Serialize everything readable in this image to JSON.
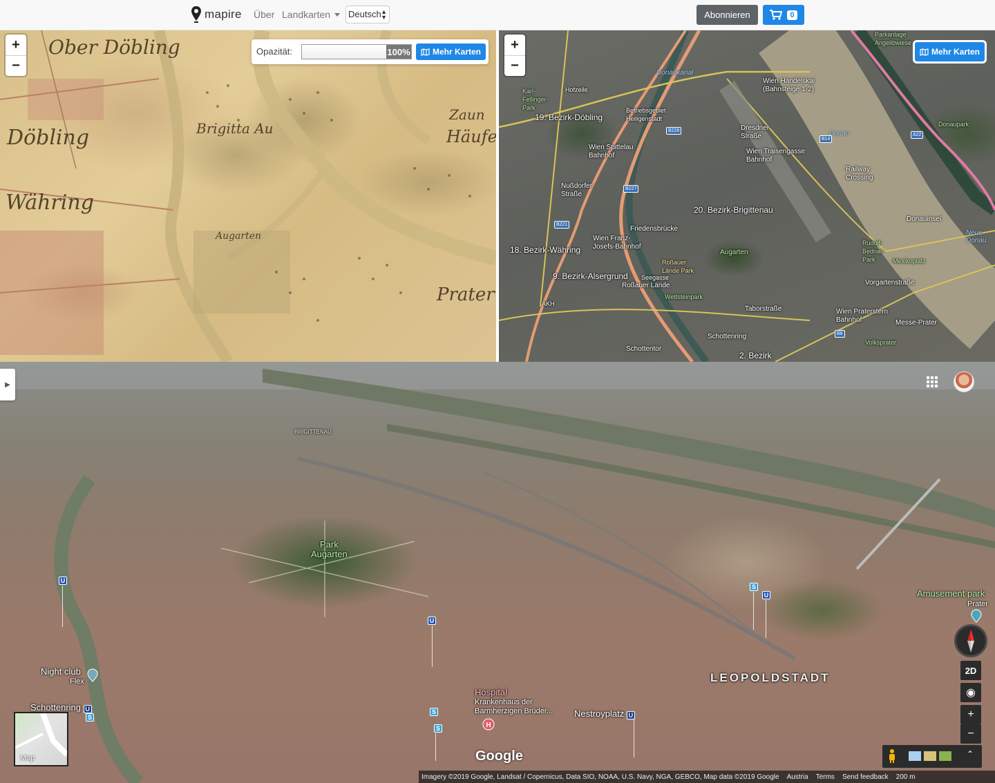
{
  "navbar": {
    "brand": "mapire",
    "links": {
      "ueber": "Über",
      "landkarten": "Landkarten"
    },
    "language": "Deutsch",
    "subscribe": "Abonnieren",
    "cart_count": "0"
  },
  "historic_map": {
    "zoom_in": "+",
    "zoom_out": "−",
    "opacity_label": "Opazität:",
    "opacity_value": "100%",
    "opacity_fraction": 1.0,
    "more_maps": "Mehr Karten",
    "labels": {
      "oberdobling": "Ober Döbling",
      "dobling": "Döbling",
      "wahring": "Währing",
      "prater": "Prater",
      "haufel": "Häufel",
      "zaun": "Zaun",
      "brigitta": "Brigitta Au",
      "augarten": "Augarten"
    }
  },
  "satellite_map": {
    "zoom_in": "+",
    "zoom_out": "−",
    "more_maps": "Mehr Karten",
    "labels": {
      "bezirk19": "19. Bezirk-Döbling",
      "bezirk20": "20. Bezirk-Brigittenau",
      "bezirk18": "18. Bezirk-Währing",
      "bezirk9": "9. Bezirk-Alsergrund",
      "bezirk2": "2. Bezirk",
      "handelskai": "Wien Handelskai (Bahnsteige 1-2)",
      "traisengasse": "Wien Traisengasse Bahnhof",
      "spittelau": "Wien Spittelau Bahnhof",
      "franzjosefs": "Wien Franz-Josefs-Bahnhof",
      "nussdorfer": "Nußdorfer Straße",
      "friedensbruecke": "Friedensbrücke",
      "rossauer_park": "Roßauer Lände Park",
      "rossauer_laende": "Roßauer Lände",
      "augarten": "Augarten",
      "donauinsel": "Donauinsel",
      "vorgartenstrasse": "Vorgartenstraße",
      "mexikoplatz": "Mexikoplatz",
      "praterstern": "Wien Praterstern Bahnhof",
      "messe_prater": "Messe-Prater",
      "taborstrasse": "Taborstraße",
      "schottenring": "Schottenring",
      "schottentor": "Schottentor",
      "neue_donau": "Neue Donau",
      "donaukanal": "Donaukanal",
      "donau": "Donau",
      "dresdner": "Dresdner Straße",
      "railway_crossing": "Railway Crossing",
      "donaupark": "Donaupark",
      "karl_fellinger": "Karl-Fellinger-Park",
      "heiligenstadt": "Betriebsgebiet Heiligenstadt",
      "volksprater": "Volksprater",
      "seegasse": "Seegasse",
      "wettsteinpark": "Wettsteinpark",
      "akh": "AKH",
      "hoefzeile": "Hofzeile",
      "parkanlage": "Parkanlage Angelibwiese",
      "rudolf_bednar": "Rudolf-Bednar-Park"
    }
  },
  "earth_3d": {
    "labels": {
      "brigittenau": "BRIGITTENAU",
      "park_augarten": "Park\nAugarten",
      "amusement_park": "Amusement park",
      "prater": "Prater",
      "night_club": "Night club",
      "flex": "Flex",
      "schottenring": "Schottenring",
      "hospital": "Hospital",
      "krankenhaus": "Krankenhaus der\nBarmherzigen Brüder...",
      "nestroyplatz": "Nestroyplatz",
      "leopoldstadt": "LEOPOLDSTADT"
    },
    "mini_map_label": "Map",
    "view_2d": "2D",
    "google": "Google",
    "attribution": {
      "imagery": "Imagery ©2019 Google, Landsat / Copernicus, Data SIO, NOAA, U.S. Navy, NGA, GEBCO, Map data ©2019 Google",
      "country": "Austria",
      "terms": "Terms",
      "feedback": "Send feedback",
      "scale": "200 m"
    }
  },
  "colors": {
    "primary_blue": "#1f87e6",
    "dark_button": "#5e6368",
    "map_road_orange": "#e59b74"
  }
}
